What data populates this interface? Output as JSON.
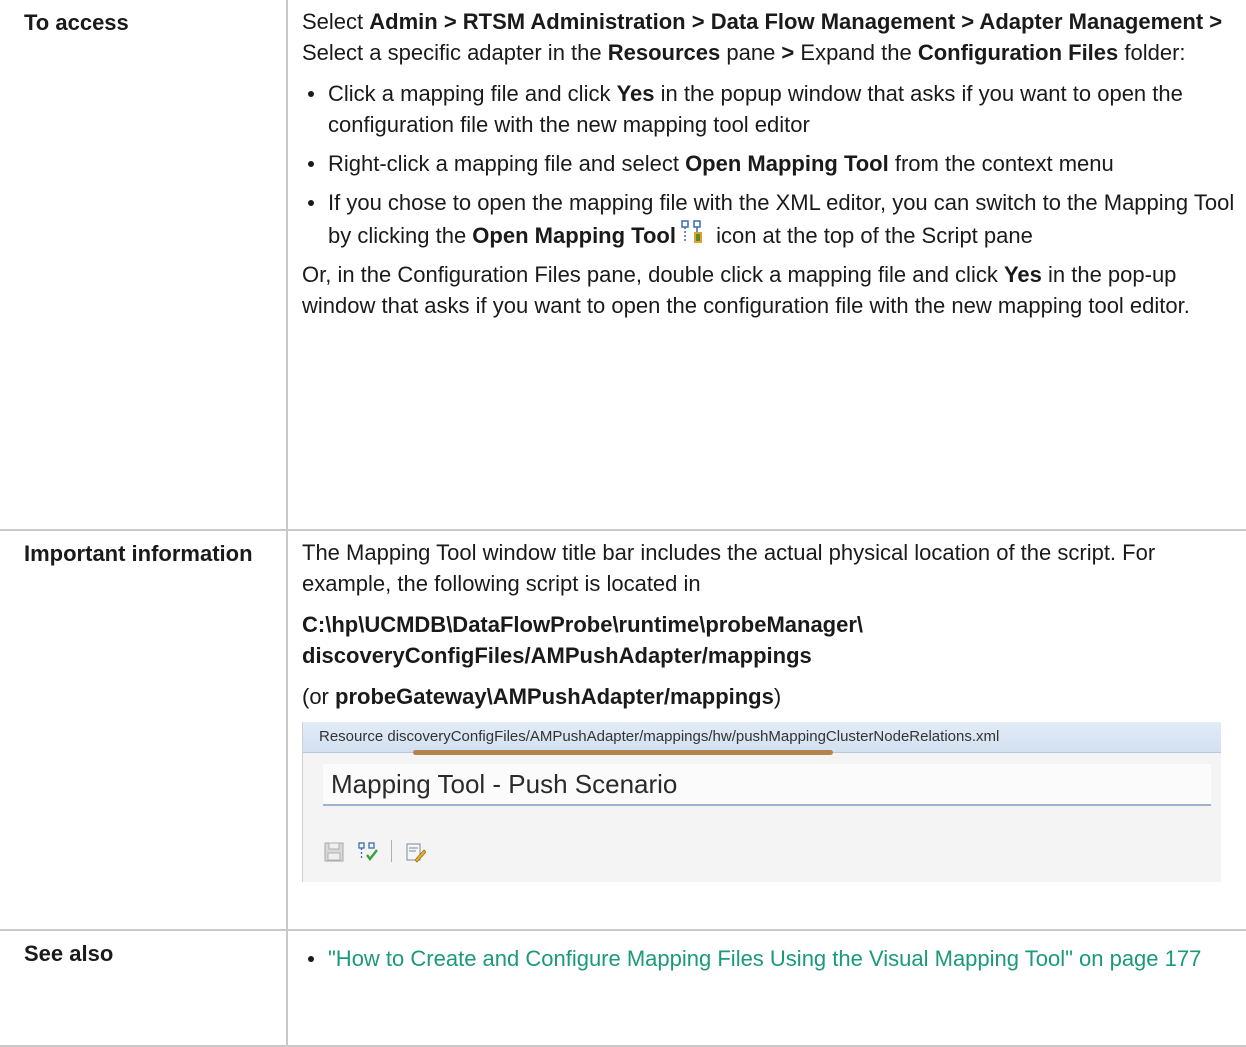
{
  "rows": {
    "access": {
      "label": "To access",
      "intro": {
        "t1": "Select ",
        "b1": "Admin > RTSM Administration > Data Flow Management > Adapter Management >",
        "t2": "  Select a specific adapter in the ",
        "b2": "Resources",
        "t3": " pane ",
        "b3": ">",
        "t4": " Expand the ",
        "b4": "Configuration Files",
        "t5": " folder:"
      },
      "bullets": [
        {
          "t1": "Click a mapping file and click ",
          "b1": "Yes",
          "t2": " in the popup window that asks if you want to open the configuration file with the new mapping tool editor"
        },
        {
          "t1": "Right-click a mapping file and select ",
          "b1": "Open Mapping Tool",
          "t2": " from the context menu"
        },
        {
          "t1": "If you chose to open the mapping file with the XML editor, you can switch to the Mapping Tool by clicking the ",
          "b1": "Open Mapping Tool",
          "t2": " icon at the top of the Script pane"
        }
      ],
      "outro": {
        "t1": "Or, in the Configuration Files pane, double click a mapping file and click ",
        "b1": "Yes",
        "t2": " in the pop-up window that asks if you want to open the configuration file with the new mapping tool editor."
      }
    },
    "important": {
      "label": "Important information",
      "p1": "The Mapping Tool window title bar includes the actual physical location of the script. For example, the following script is located in",
      "path_line1": "C:\\hp\\UCMDB\\DataFlowProbe\\runtime\\probeManager\\",
      "path_line2": "discoveryConfigFiles/AMPushAdapter/mappings",
      "alt_open": "(or ",
      "alt_bold": "probeGateway\\AMPushAdapter/mappings",
      "alt_close": ")",
      "screenshot": {
        "resource_text": "Resource discoveryConfigFiles/AMPushAdapter/mappings/hw/pushMappingClusterNodeRelations.xml",
        "title": "Mapping Tool - Push Scenario",
        "toolbar_icons": [
          "save-icon",
          "open-mapping-tool-icon",
          "edit-script-icon"
        ]
      }
    },
    "see_also": {
      "label": "See also",
      "link": "\"How to Create and Configure Mapping Files Using the Visual Mapping Tool\" on page 177"
    }
  },
  "colors": {
    "link": "#1a9a7a",
    "border": "#c9c9c9",
    "underline_accent": "#b5844e"
  }
}
